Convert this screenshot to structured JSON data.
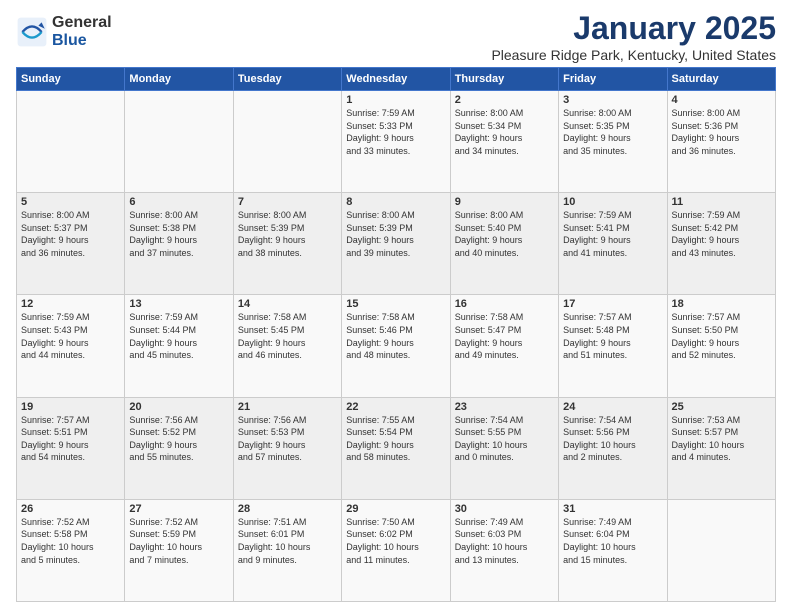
{
  "logo": {
    "general": "General",
    "blue": "Blue"
  },
  "title": "January 2025",
  "location": "Pleasure Ridge Park, Kentucky, United States",
  "days_of_week": [
    "Sunday",
    "Monday",
    "Tuesday",
    "Wednesday",
    "Thursday",
    "Friday",
    "Saturday"
  ],
  "weeks": [
    [
      {
        "day": "",
        "info": ""
      },
      {
        "day": "",
        "info": ""
      },
      {
        "day": "",
        "info": ""
      },
      {
        "day": "1",
        "info": "Sunrise: 7:59 AM\nSunset: 5:33 PM\nDaylight: 9 hours\nand 33 minutes."
      },
      {
        "day": "2",
        "info": "Sunrise: 8:00 AM\nSunset: 5:34 PM\nDaylight: 9 hours\nand 34 minutes."
      },
      {
        "day": "3",
        "info": "Sunrise: 8:00 AM\nSunset: 5:35 PM\nDaylight: 9 hours\nand 35 minutes."
      },
      {
        "day": "4",
        "info": "Sunrise: 8:00 AM\nSunset: 5:36 PM\nDaylight: 9 hours\nand 36 minutes."
      }
    ],
    [
      {
        "day": "5",
        "info": "Sunrise: 8:00 AM\nSunset: 5:37 PM\nDaylight: 9 hours\nand 36 minutes."
      },
      {
        "day": "6",
        "info": "Sunrise: 8:00 AM\nSunset: 5:38 PM\nDaylight: 9 hours\nand 37 minutes."
      },
      {
        "day": "7",
        "info": "Sunrise: 8:00 AM\nSunset: 5:39 PM\nDaylight: 9 hours\nand 38 minutes."
      },
      {
        "day": "8",
        "info": "Sunrise: 8:00 AM\nSunset: 5:39 PM\nDaylight: 9 hours\nand 39 minutes."
      },
      {
        "day": "9",
        "info": "Sunrise: 8:00 AM\nSunset: 5:40 PM\nDaylight: 9 hours\nand 40 minutes."
      },
      {
        "day": "10",
        "info": "Sunrise: 7:59 AM\nSunset: 5:41 PM\nDaylight: 9 hours\nand 41 minutes."
      },
      {
        "day": "11",
        "info": "Sunrise: 7:59 AM\nSunset: 5:42 PM\nDaylight: 9 hours\nand 43 minutes."
      }
    ],
    [
      {
        "day": "12",
        "info": "Sunrise: 7:59 AM\nSunset: 5:43 PM\nDaylight: 9 hours\nand 44 minutes."
      },
      {
        "day": "13",
        "info": "Sunrise: 7:59 AM\nSunset: 5:44 PM\nDaylight: 9 hours\nand 45 minutes."
      },
      {
        "day": "14",
        "info": "Sunrise: 7:58 AM\nSunset: 5:45 PM\nDaylight: 9 hours\nand 46 minutes."
      },
      {
        "day": "15",
        "info": "Sunrise: 7:58 AM\nSunset: 5:46 PM\nDaylight: 9 hours\nand 48 minutes."
      },
      {
        "day": "16",
        "info": "Sunrise: 7:58 AM\nSunset: 5:47 PM\nDaylight: 9 hours\nand 49 minutes."
      },
      {
        "day": "17",
        "info": "Sunrise: 7:57 AM\nSunset: 5:48 PM\nDaylight: 9 hours\nand 51 minutes."
      },
      {
        "day": "18",
        "info": "Sunrise: 7:57 AM\nSunset: 5:50 PM\nDaylight: 9 hours\nand 52 minutes."
      }
    ],
    [
      {
        "day": "19",
        "info": "Sunrise: 7:57 AM\nSunset: 5:51 PM\nDaylight: 9 hours\nand 54 minutes."
      },
      {
        "day": "20",
        "info": "Sunrise: 7:56 AM\nSunset: 5:52 PM\nDaylight: 9 hours\nand 55 minutes."
      },
      {
        "day": "21",
        "info": "Sunrise: 7:56 AM\nSunset: 5:53 PM\nDaylight: 9 hours\nand 57 minutes."
      },
      {
        "day": "22",
        "info": "Sunrise: 7:55 AM\nSunset: 5:54 PM\nDaylight: 9 hours\nand 58 minutes."
      },
      {
        "day": "23",
        "info": "Sunrise: 7:54 AM\nSunset: 5:55 PM\nDaylight: 10 hours\nand 0 minutes."
      },
      {
        "day": "24",
        "info": "Sunrise: 7:54 AM\nSunset: 5:56 PM\nDaylight: 10 hours\nand 2 minutes."
      },
      {
        "day": "25",
        "info": "Sunrise: 7:53 AM\nSunset: 5:57 PM\nDaylight: 10 hours\nand 4 minutes."
      }
    ],
    [
      {
        "day": "26",
        "info": "Sunrise: 7:52 AM\nSunset: 5:58 PM\nDaylight: 10 hours\nand 5 minutes."
      },
      {
        "day": "27",
        "info": "Sunrise: 7:52 AM\nSunset: 5:59 PM\nDaylight: 10 hours\nand 7 minutes."
      },
      {
        "day": "28",
        "info": "Sunrise: 7:51 AM\nSunset: 6:01 PM\nDaylight: 10 hours\nand 9 minutes."
      },
      {
        "day": "29",
        "info": "Sunrise: 7:50 AM\nSunset: 6:02 PM\nDaylight: 10 hours\nand 11 minutes."
      },
      {
        "day": "30",
        "info": "Sunrise: 7:49 AM\nSunset: 6:03 PM\nDaylight: 10 hours\nand 13 minutes."
      },
      {
        "day": "31",
        "info": "Sunrise: 7:49 AM\nSunset: 6:04 PM\nDaylight: 10 hours\nand 15 minutes."
      },
      {
        "day": "",
        "info": ""
      }
    ]
  ]
}
